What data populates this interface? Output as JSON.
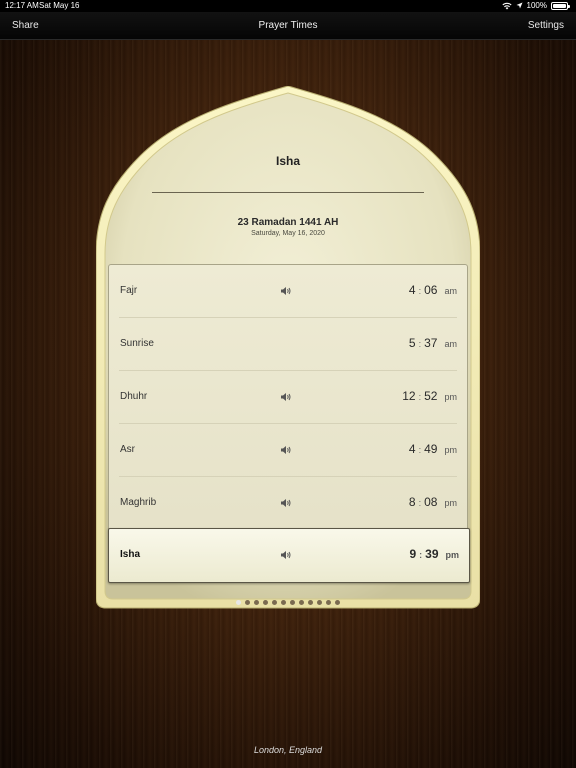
{
  "status_bar": {
    "time": "12:17 AM",
    "date": "Sat May 16",
    "battery": "100%"
  },
  "nav": {
    "left": "Share",
    "title": "Prayer Times",
    "right": "Settings"
  },
  "card": {
    "current_prayer": "Isha",
    "hijri_date": "23 Ramadan 1441 AH",
    "gregorian_date": "Saturday, May 16, 2020"
  },
  "prayers": [
    {
      "name": "Fajr",
      "hour": "4",
      "minute": "06",
      "period": "am",
      "sound": true
    },
    {
      "name": "Sunrise",
      "hour": "5",
      "minute": "37",
      "period": "am",
      "sound": false
    },
    {
      "name": "Dhuhr",
      "hour": "12",
      "minute": "52",
      "period": "pm",
      "sound": true
    },
    {
      "name": "Asr",
      "hour": "4",
      "minute": "49",
      "period": "pm",
      "sound": true
    },
    {
      "name": "Maghrib",
      "hour": "8",
      "minute": "08",
      "period": "pm",
      "sound": true
    },
    {
      "name": "Isha",
      "hour": "9",
      "minute": "39",
      "period": "pm",
      "sound": true
    }
  ],
  "active_index": 5,
  "page_dots": {
    "count": 12,
    "current": 0
  },
  "location": "London, England",
  "colors": {
    "card_border": "#f6f0b8",
    "card_face": "#eeeacb",
    "wood_dark": "#1c0d04"
  },
  "icons": {
    "speaker": "speaker-icon",
    "wifi": "wifi-icon",
    "location": "location-arrow-icon"
  }
}
